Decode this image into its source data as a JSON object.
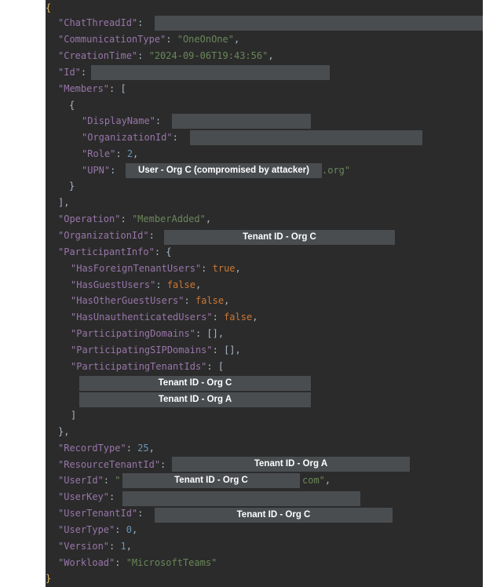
{
  "json": {
    "open_brace": "{",
    "close_brace": "}",
    "chat_thread_id_key": "\"ChatThreadId\"",
    "communication_type_key": "\"CommunicationType\"",
    "communication_type_val": "\"OneOnOne\"",
    "creation_time_key": "\"CreationTime\"",
    "creation_time_val": "\"2024-09-06T19:43:56\"",
    "id_key": "\"Id\"",
    "members_key": "\"Members\"",
    "display_name_key": "\"DisplayName\"",
    "member_org_id_key": "\"OrganizationId\"",
    "role_key": "\"Role\"",
    "role_val": "2",
    "upn_key": "\"UPN\"",
    "upn_suffix": ".org\"",
    "operation_key": "\"Operation\"",
    "operation_val": "\"MemberAdded\"",
    "organization_id_key": "\"OrganizationId\"",
    "participant_info_key": "\"ParticipantInfo\"",
    "has_foreign_key": "\"HasForeignTenantUsers\"",
    "has_foreign_val": "true",
    "has_guest_key": "\"HasGuestUsers\"",
    "has_guest_val": "false",
    "has_other_guest_key": "\"HasOtherGuestUsers\"",
    "has_other_guest_val": "false",
    "has_unauth_key": "\"HasUnauthenticatedUsers\"",
    "has_unauth_val": "false",
    "participating_domains_key": "\"ParticipatingDomains\"",
    "participating_domains_val": "[]",
    "participating_sip_key": "\"ParticipatingSIPDomains\"",
    "participating_sip_val": "[]",
    "participating_tenant_key": "\"ParticipatingTenantIds\"",
    "record_type_key": "\"RecordType\"",
    "record_type_val": "25",
    "resource_tenant_key": "\"ResourceTenantId\"",
    "user_id_key": "\"UserId\"",
    "user_id_suffix": "com\"",
    "user_key_key": "\"UserKey\"",
    "user_tenant_key": "\"UserTenantId\"",
    "user_type_key": "\"UserType\"",
    "user_type_val": "0",
    "version_key": "\"Version\"",
    "version_val": "1",
    "workload_key": "\"Workload\"",
    "workload_val": "\"MicrosoftTeams\""
  },
  "annotations": {
    "upn_label": "User - Org C (compromised by attacker)",
    "organization_id_label": "Tenant ID - Org C",
    "participating_tenant_1": "Tenant ID - Org C",
    "participating_tenant_2": "Tenant ID - Org A",
    "resource_tenant_label": "Tenant ID - Org A",
    "user_id_label": "Tenant ID - Org C",
    "user_tenant_label": "Tenant ID - Org C"
  }
}
